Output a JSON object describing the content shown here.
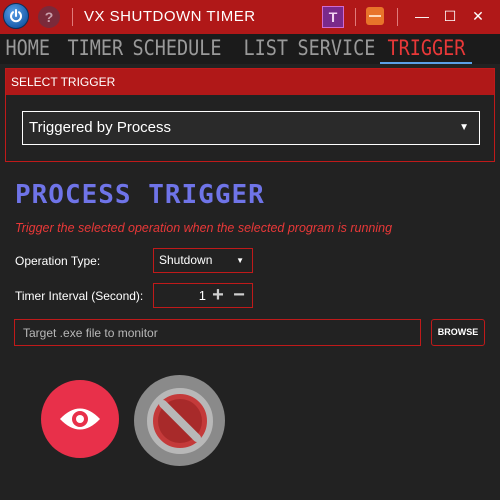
{
  "window": {
    "title": "VX SHUTDOWN TIMER",
    "help_label": "?",
    "t_label": "T",
    "minimize_label": "—",
    "maximize_label": "☐",
    "close_label": "✕"
  },
  "nav": {
    "items": [
      {
        "label": "HOME",
        "active": false
      },
      {
        "label": "TIMER",
        "active": false
      },
      {
        "label": "SCHEDULE",
        "active": false
      },
      {
        "label": "LIST",
        "active": false
      },
      {
        "label": "SERVICE",
        "active": false
      },
      {
        "label": "TRIGGER",
        "active": true
      }
    ]
  },
  "select_trigger": {
    "header": "SELECT TRIGGER",
    "selected": "Triggered by Process"
  },
  "process_trigger": {
    "title": "PROCESS TRIGGER",
    "description": "Trigger the selected operation when the selected program is running",
    "operation_type_label": "Operation Type:",
    "operation_type_value": "Shutdown",
    "timer_interval_label": "Timer Interval (Second):",
    "timer_interval_value": "1",
    "file_placeholder": "Target .exe file to monitor",
    "browse_label": "BROWSE"
  },
  "colors": {
    "accent_red": "#b01818",
    "active_nav": "#e83838",
    "title_blue": "#6f74e8",
    "background": "#222222"
  },
  "icons": {
    "power": "power-icon",
    "help": "help-icon",
    "eye": "eye-icon",
    "stop": "prohibited-icon"
  }
}
